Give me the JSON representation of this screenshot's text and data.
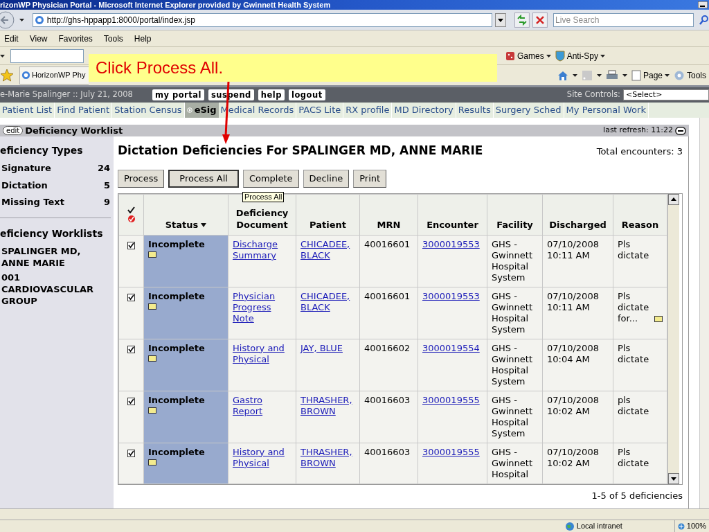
{
  "window": {
    "title": "rizonWP Physician Portal - Microsoft Internet Explorer provided by Gwinnett Health System"
  },
  "address_bar": {
    "url": "http://ghs-hppapp1:8000/portal/index.jsp"
  },
  "search": {
    "placeholder": "Live Search"
  },
  "menu": [
    "Edit",
    "View",
    "Favorites",
    "Tools",
    "Help"
  ],
  "links_toolbar": [
    "Games",
    "Anti-Spy"
  ],
  "browser_tab": {
    "label": "HorizonWP Phy"
  },
  "command_bar": [
    "Page",
    "Tools"
  ],
  "callout": {
    "text": "Click Process All."
  },
  "portal_header": {
    "user": "e-Marie Spalinger :: July 21, 2008",
    "buttons": [
      "my portal",
      "suspend",
      "help",
      "logout"
    ],
    "site_controls_label": "Site Controls:",
    "site_controls_value": "<Select>"
  },
  "nav_tabs": [
    {
      "label": "Patient List",
      "selected": false
    },
    {
      "label": "Find Patient",
      "selected": false
    },
    {
      "label": "Station Census",
      "selected": false
    },
    {
      "label": "eSig",
      "selected": true
    },
    {
      "label": "Medical Records",
      "selected": false
    },
    {
      "label": "PACS Lite",
      "selected": false
    },
    {
      "label": "RX profile",
      "selected": false
    },
    {
      "label": "MD Directory",
      "selected": false
    },
    {
      "label": "Results",
      "selected": false
    },
    {
      "label": "Surgery Sched",
      "selected": false
    },
    {
      "label": "My Personal Work",
      "selected": false
    }
  ],
  "portlet": {
    "edit": "edit",
    "title": "Deficiency Worklist",
    "last_refresh": "last refresh: 11:22"
  },
  "sidebar": {
    "types_title": "eficiency Types",
    "types": [
      {
        "label": "Signature",
        "count": "24"
      },
      {
        "label": "Dictation",
        "count": "5"
      },
      {
        "label": "Missing Text",
        "count": "9"
      }
    ],
    "worklists_title": "eficiency Worklists",
    "worklists": [
      "SPALINGER MD, ANNE MARIE",
      "001 CARDIOVASCULAR GROUP"
    ]
  },
  "heading": "Dictation Deficiencies For SPALINGER MD, ANNE MARIE",
  "total": "Total encounters: 3",
  "actions": [
    {
      "label": "Process",
      "selected": false
    },
    {
      "label": "Process All",
      "selected": true
    },
    {
      "label": "Complete",
      "selected": false
    },
    {
      "label": "Decline",
      "selected": false
    },
    {
      "label": "Print",
      "selected": false
    }
  ],
  "tooltip": "Process All",
  "table": {
    "columns": [
      {
        "label": "Status",
        "sorted": true
      },
      {
        "label": "Deficiency Document",
        "sorted": false
      },
      {
        "label": "Patient",
        "sorted": false
      },
      {
        "label": "MRN",
        "sorted": false
      },
      {
        "label": "Encounter",
        "sorted": false
      },
      {
        "label": "Facility",
        "sorted": false
      },
      {
        "label": "Discharged",
        "sorted": false
      },
      {
        "label": "Reason",
        "sorted": false
      }
    ],
    "rows": [
      {
        "checked": true,
        "status": "Incomplete",
        "document": "Discharge Summary",
        "patient": "CHICADEE, BLACK",
        "mrn": "40016601",
        "encounter": "3000019553",
        "facility": "GHS - Gwinnett Hospital System",
        "discharged": "07/10/2008 10:11 AM",
        "reason": "Pls dictate",
        "reason_note": false
      },
      {
        "checked": true,
        "status": "Incomplete",
        "document": "Physician Progress Note",
        "patient": "CHICADEE, BLACK",
        "mrn": "40016601",
        "encounter": "3000019553",
        "facility": "GHS - Gwinnett Hospital System",
        "discharged": "07/10/2008 10:11 AM",
        "reason": "Pls dictate for...",
        "reason_note": true
      },
      {
        "checked": true,
        "status": "Incomplete",
        "document": "History and Physical",
        "patient": "JAY, BLUE",
        "mrn": "40016602",
        "encounter": "3000019554",
        "facility": "GHS - Gwinnett Hospital System",
        "discharged": "07/10/2008 10:04 AM",
        "reason": "Pls dictate",
        "reason_note": false
      },
      {
        "checked": true,
        "status": "Incomplete",
        "document": "Gastro Report",
        "patient": "THRASHER, BROWN",
        "mrn": "40016603",
        "encounter": "3000019555",
        "facility": "GHS - Gwinnett Hospital System",
        "discharged": "07/10/2008 10:02 AM",
        "reason": "pls dictate",
        "reason_note": false
      },
      {
        "checked": true,
        "status": "Incomplete",
        "document": "History and Physical",
        "patient": "THRASHER, BROWN",
        "mrn": "40016603",
        "encounter": "3000019555",
        "facility": "GHS - Gwinnett Hospital",
        "discharged": "07/10/2008 10:02 AM",
        "reason": "Pls dictate",
        "reason_note": false
      }
    ]
  },
  "footer": "1-5 of 5 deficiencies",
  "status_bar": {
    "zone": "Local intranet",
    "zoom": "100%"
  }
}
